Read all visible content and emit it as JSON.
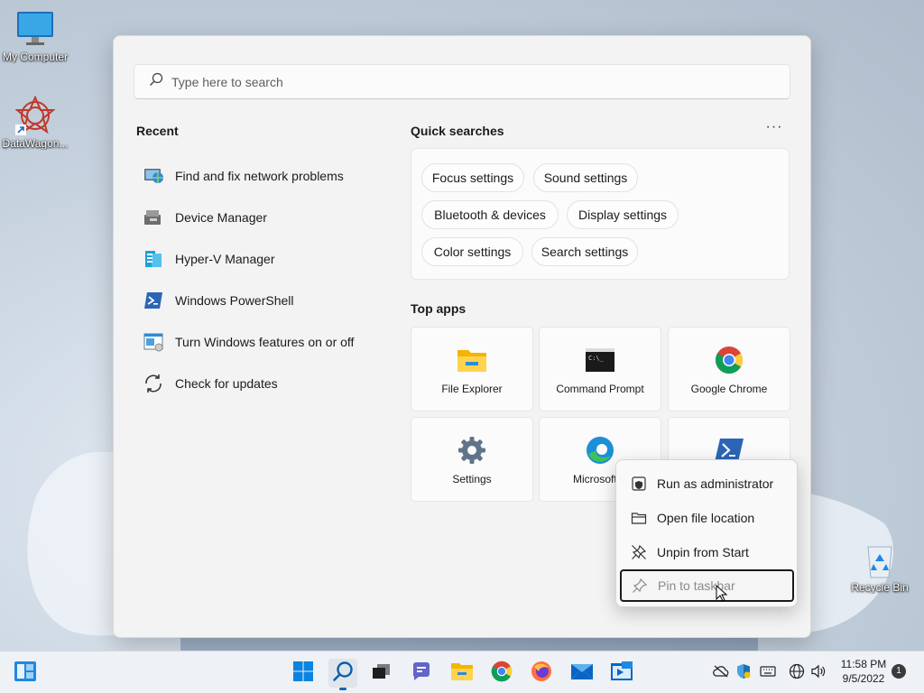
{
  "desktop": {
    "icons": [
      {
        "label": "My Computer",
        "icon": "monitor-icon"
      },
      {
        "label": "DataWagon...",
        "icon": "datawagon-shortcut-icon"
      },
      {
        "label": "Recycle Bin",
        "icon": "recycle-bin-icon"
      }
    ]
  },
  "start_menu": {
    "search": {
      "placeholder": "Type here to search",
      "icon": "search-icon"
    },
    "recent": {
      "title": "Recent",
      "items": [
        {
          "label": "Find and fix network problems",
          "icon": "network-troubleshoot-icon"
        },
        {
          "label": "Device Manager",
          "icon": "device-manager-icon"
        },
        {
          "label": "Hyper-V Manager",
          "icon": "hyper-v-icon"
        },
        {
          "label": "Windows PowerShell",
          "icon": "powershell-icon"
        },
        {
          "label": "Turn Windows features on or off",
          "icon": "windows-features-icon"
        },
        {
          "label": "Check for updates",
          "icon": "update-icon"
        }
      ]
    },
    "quick_searches": {
      "title": "Quick searches",
      "more_label": "···",
      "chips": [
        "Focus settings",
        "Sound settings",
        "Bluetooth & devices",
        "Display settings",
        "Color settings",
        "Search settings"
      ]
    },
    "top_apps": {
      "title": "Top apps",
      "apps": [
        {
          "label": "File Explorer",
          "icon": "file-explorer-icon"
        },
        {
          "label": "Command Prompt",
          "icon": "command-prompt-icon"
        },
        {
          "label": "Google Chrome",
          "icon": "chrome-icon"
        },
        {
          "label": "Settings",
          "icon": "settings-gear-icon"
        },
        {
          "label": "Microsoft E",
          "icon": "edge-icon"
        },
        {
          "label": "",
          "icon": "powershell-icon"
        }
      ]
    }
  },
  "context_menu": {
    "items": [
      {
        "label": "Run as administrator",
        "icon": "shield-icon"
      },
      {
        "label": "Open file location",
        "icon": "folder-icon"
      },
      {
        "label": "Unpin from Start",
        "icon": "unpin-icon"
      },
      {
        "label": "Pin to taskbar",
        "icon": "pin-icon",
        "state": "focused-disabled"
      }
    ]
  },
  "taskbar": {
    "left_widget_icon": "widgets-icon",
    "apps": [
      {
        "name": "Start",
        "icon": "windows-logo-icon"
      },
      {
        "name": "Search",
        "icon": "search-icon",
        "active": true
      },
      {
        "name": "Task View",
        "icon": "task-view-icon"
      },
      {
        "name": "Chat",
        "icon": "teams-chat-icon"
      },
      {
        "name": "File Explorer",
        "icon": "file-explorer-icon"
      },
      {
        "name": "Google Chrome",
        "icon": "chrome-icon"
      },
      {
        "name": "Firefox",
        "icon": "firefox-icon"
      },
      {
        "name": "Mail",
        "icon": "mail-icon"
      },
      {
        "name": "Remote Desktop",
        "icon": "remote-desktop-icon"
      }
    ],
    "tray": {
      "icons": [
        "cloud-offline-icon",
        "security-shield-icon",
        "keyboard-icon",
        "network-globe-icon",
        "volume-icon"
      ],
      "time": "11:58 PM",
      "date": "9/5/2022",
      "notification_count": "1"
    }
  },
  "colors": {
    "accent": "#0067c0",
    "menu_bg": "#f3f3f3",
    "taskbar_bg": "#eef1f5"
  }
}
